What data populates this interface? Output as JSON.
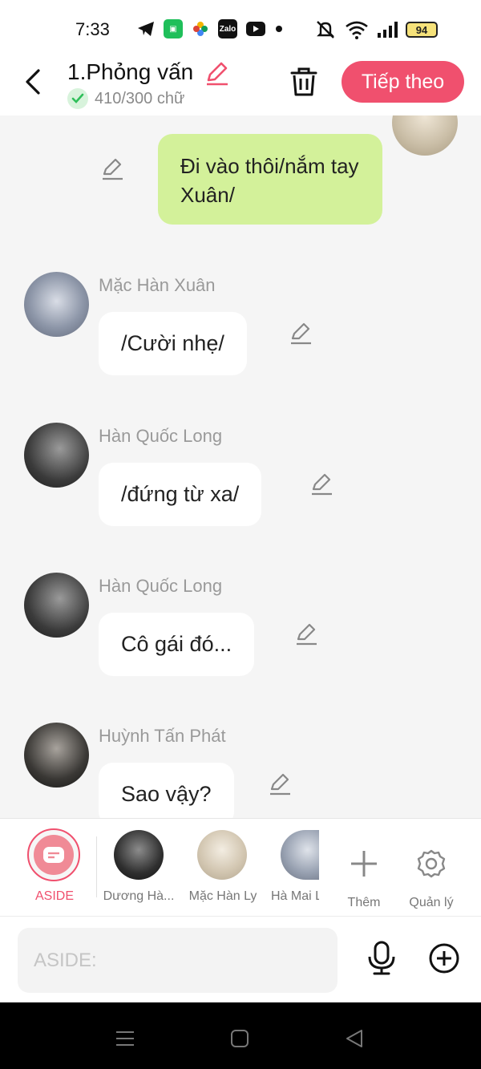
{
  "status": {
    "time": "7:33",
    "battery": "94",
    "app_icons": [
      "telegram-icon",
      "wechat-icon",
      "photos-icon",
      "zalo-icon",
      "youtube-icon",
      "dot-icon"
    ],
    "zalo": "Zalo"
  },
  "header": {
    "title": "1.Phỏng vấn",
    "word_count": "410/300 chữ",
    "next_label": "Tiếp theo",
    "accent": "#f0506e"
  },
  "chat": {
    "my_message": "Đi vào thôi/nắm tay Xuân/",
    "messages": [
      {
        "name": "Mặc Hàn Xuân",
        "text": "/Cười nhẹ/"
      },
      {
        "name": "Hàn Quốc Long",
        "text": "/đứng từ xa/"
      },
      {
        "name": "Hàn Quốc Long",
        "text": "Cô gái đó..."
      },
      {
        "name": "Huỳnh Tấn Phát",
        "text": "Sao vậy?"
      }
    ]
  },
  "characters": {
    "aside_label": "ASIDE",
    "items": [
      {
        "label": "Dương Hà..."
      },
      {
        "label": "Mặc Hàn Ly"
      },
      {
        "label": "Hà Mai L"
      }
    ],
    "more_label": "Thêm",
    "manage_label": "Quản lý"
  },
  "input": {
    "placeholder": "ASIDE:",
    "value": ""
  }
}
